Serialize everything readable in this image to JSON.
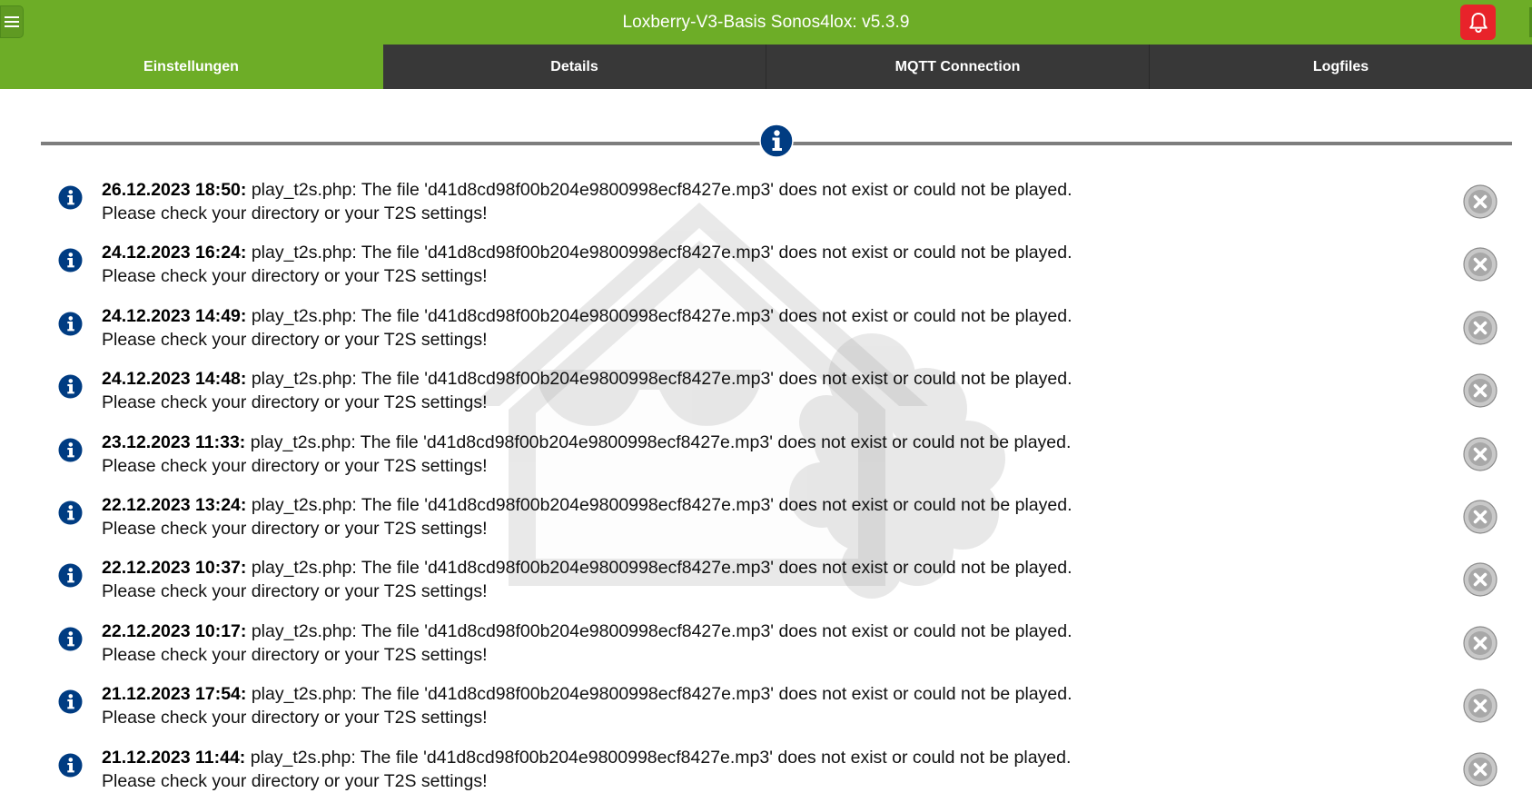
{
  "header": {
    "title": "Loxberry-V3-Basis Sonos4lox: v5.3.9",
    "menu_icon": "hamburger-menu-icon",
    "notify_icon": "bell-icon",
    "accent_color": "#6dad27",
    "notify_color": "#e8232a"
  },
  "tabs": [
    {
      "label": "Einstellungen",
      "active": true
    },
    {
      "label": "Details",
      "active": false
    },
    {
      "label": "MQTT Connection",
      "active": false
    },
    {
      "label": "Logfiles",
      "active": false
    }
  ],
  "divider_icon": "info-icon",
  "messages": [
    {
      "timestamp": "26.12.2023 18:50:",
      "text": "play_t2s.php: The file 'd41d8cd98f00b204e9800998ecf8427e.mp3' does not exist or could not be played.",
      "text2": "Please check your directory or your T2S settings!"
    },
    {
      "timestamp": "24.12.2023 16:24:",
      "text": "play_t2s.php: The file 'd41d8cd98f00b204e9800998ecf8427e.mp3' does not exist or could not be played.",
      "text2": "Please check your directory or your T2S settings!"
    },
    {
      "timestamp": "24.12.2023 14:49:",
      "text": "play_t2s.php: The file 'd41d8cd98f00b204e9800998ecf8427e.mp3' does not exist or could not be played.",
      "text2": "Please check your directory or your T2S settings!"
    },
    {
      "timestamp": "24.12.2023 14:48:",
      "text": "play_t2s.php: The file 'd41d8cd98f00b204e9800998ecf8427e.mp3' does not exist or could not be played.",
      "text2": "Please check your directory or your T2S settings!"
    },
    {
      "timestamp": "23.12.2023 11:33:",
      "text": "play_t2s.php: The file 'd41d8cd98f00b204e9800998ecf8427e.mp3' does not exist or could not be played.",
      "text2": "Please check your directory or your T2S settings!"
    },
    {
      "timestamp": "22.12.2023 13:24:",
      "text": "play_t2s.php: The file 'd41d8cd98f00b204e9800998ecf8427e.mp3' does not exist or could not be played.",
      "text2": "Please check your directory or your T2S settings!"
    },
    {
      "timestamp": "22.12.2023 10:37:",
      "text": "play_t2s.php: The file 'd41d8cd98f00b204e9800998ecf8427e.mp3' does not exist or could not be played.",
      "text2": "Please check your directory or your T2S settings!"
    },
    {
      "timestamp": "22.12.2023 10:17:",
      "text": "play_t2s.php: The file 'd41d8cd98f00b204e9800998ecf8427e.mp3' does not exist or could not be played.",
      "text2": "Please check your directory or your T2S settings!"
    },
    {
      "timestamp": "21.12.2023 17:54:",
      "text": "play_t2s.php: The file 'd41d8cd98f00b204e9800998ecf8427e.mp3' does not exist or could not be played.",
      "text2": "Please check your directory or your T2S settings!"
    },
    {
      "timestamp": "21.12.2023 11:44:",
      "text": "play_t2s.php: The file 'd41d8cd98f00b204e9800998ecf8427e.mp3' does not exist or could not be played.",
      "text2": "Please check your directory or your T2S settings!"
    }
  ],
  "message_icon": "info-icon",
  "close_icon": "close-circle-icon"
}
